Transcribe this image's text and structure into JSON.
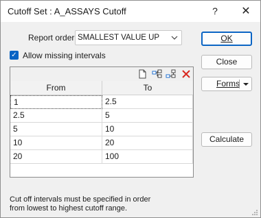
{
  "window": {
    "title": "Cutoff Set : A_ASSAYS Cutoff",
    "help_glyph": "?",
    "close_glyph": "✕"
  },
  "report_order": {
    "label": "Report order",
    "value": "SMALLEST VALUE UP"
  },
  "allow_missing": {
    "label": "Allow missing intervals",
    "checked": true
  },
  "grid": {
    "toolbar_icons": [
      "new-document-icon",
      "insert-row-icon",
      "append-row-icon",
      "delete-icon"
    ],
    "columns": [
      "From",
      "To"
    ],
    "rows": [
      {
        "from": "1",
        "to": "2.5"
      },
      {
        "from": "2.5",
        "to": "5"
      },
      {
        "from": "5",
        "to": "10"
      },
      {
        "from": "10",
        "to": "20"
      },
      {
        "from": "20",
        "to": "100"
      }
    ]
  },
  "buttons": {
    "ok": "OK",
    "close": "Close",
    "forms": "Forms",
    "calculate": "Calculate"
  },
  "hint": {
    "line1": "Cut off intervals must be specified in order",
    "line2": "from lowest to highest cutoff range."
  },
  "colors": {
    "accent": "#0a64c4",
    "delete_red": "#d9281f"
  }
}
